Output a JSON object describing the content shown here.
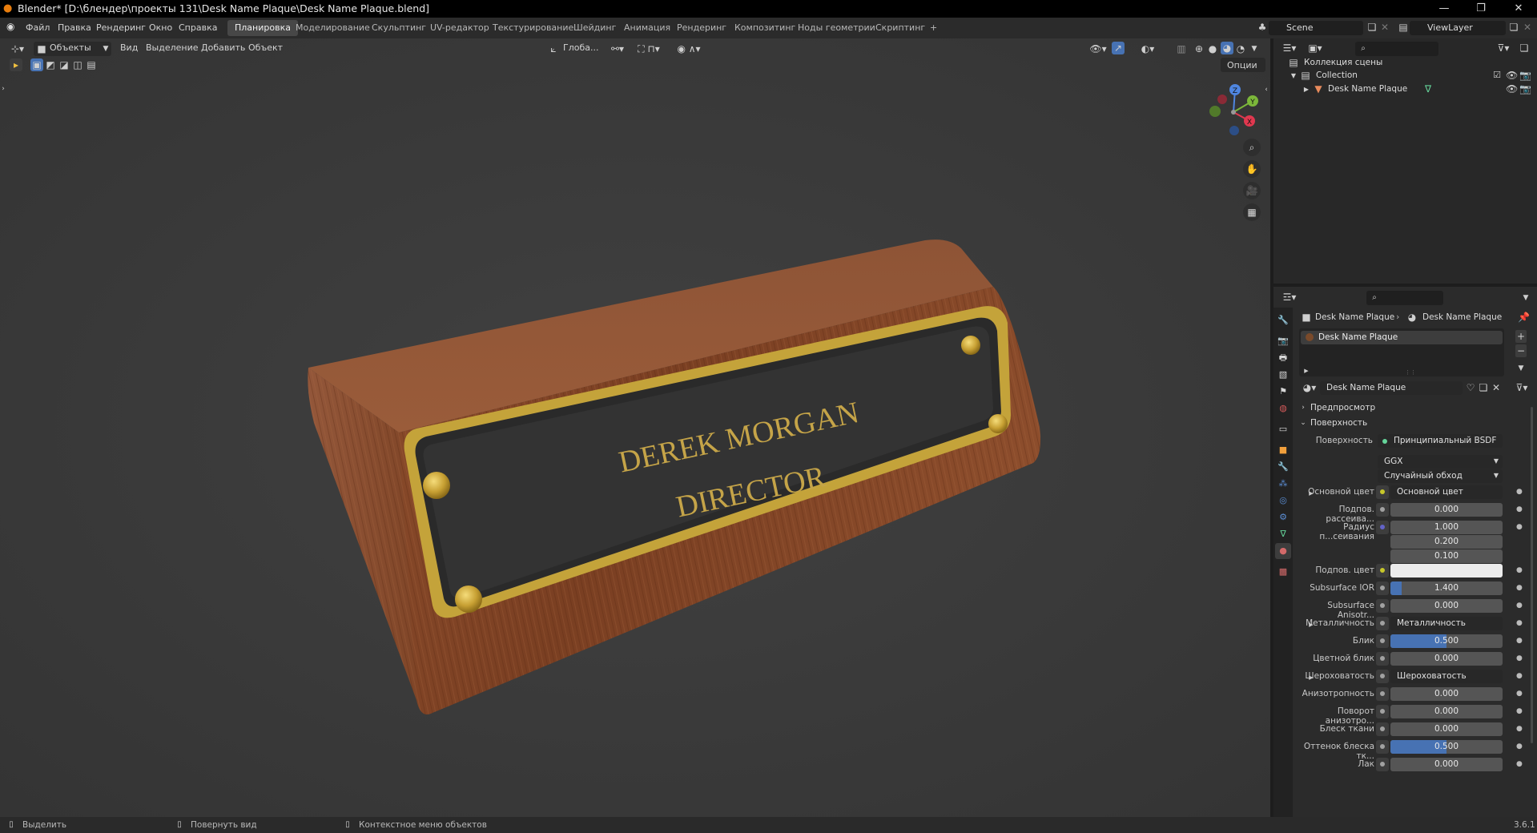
{
  "window": {
    "title": "Blender* [D:\\блендер\\проекты 131\\Desk Name Plaque\\Desk Name Plaque.blend]"
  },
  "menu": [
    "Файл",
    "Правка",
    "Рендеринг",
    "Окно",
    "Справка"
  ],
  "workspaces": [
    "Планировка",
    "Моделирование",
    "Скульптинг",
    "UV-редактор",
    "Текстурирование",
    "Шейдинг",
    "Анимация",
    "Рендеринг",
    "Композитинг",
    "Ноды геометрии",
    "Скриптинг"
  ],
  "workspace_add": "+",
  "scene": {
    "name": "Scene",
    "view_layer": "ViewLayer"
  },
  "viewport": {
    "mode": "Объекты",
    "menus": [
      "Вид",
      "Выделение",
      "Добавить",
      "Объект"
    ],
    "transform": "Глоба...",
    "options": "Опции",
    "plaque_line1": "DEREK MORGAN",
    "plaque_line2": "DIRECTOR",
    "axes": {
      "x": "X",
      "y": "Y",
      "z": "Z"
    }
  },
  "outliner": {
    "root": "Коллекция сцены",
    "collection": "Collection",
    "object": "Desk Name Plaque"
  },
  "properties": {
    "breadcrumb_object": "Desk Name Plaque",
    "breadcrumb_material": "Desk Name Plaque",
    "slot": "Desk Name Plaque",
    "material_name": "Desk Name Plaque",
    "sections": {
      "preview": "Предпросмотр",
      "surface": "Поверхность"
    },
    "surface_label": "Поверхность",
    "surface_value": "Принципиальный BSDF",
    "distribution": "GGX",
    "subsurface_method": "Случайный обход",
    "rows": [
      {
        "label": "Основной цвет",
        "kind": "link",
        "value": "Основной цвет",
        "color": "#c7c72a",
        "expand": true
      },
      {
        "label": "Подпов. рассеива...",
        "kind": "num",
        "value": "0.000",
        "color": "#a1a1a1"
      },
      {
        "label": "Радиус п...сеивания",
        "kind": "num",
        "value": "1.000",
        "color": "#6363c7"
      },
      {
        "label": "",
        "kind": "num",
        "value": "0.200"
      },
      {
        "label": "",
        "kind": "num",
        "value": "0.100"
      },
      {
        "label": "Подпов. цвет",
        "kind": "color",
        "value": "",
        "color": "#c7c72a"
      },
      {
        "label": "Subsurface IOR",
        "kind": "num",
        "value": "1.400",
        "color": "#a1a1a1",
        "fill": 0.1
      },
      {
        "label": "Subsurface Anisotr...",
        "kind": "num",
        "value": "0.000",
        "color": "#a1a1a1"
      },
      {
        "label": "Металличность",
        "kind": "link",
        "value": "Металличность",
        "color": "#a1a1a1",
        "expand": true
      },
      {
        "label": "Блик",
        "kind": "num",
        "value": "0.500",
        "color": "#a1a1a1",
        "fill": 0.5
      },
      {
        "label": "Цветной блик",
        "kind": "num",
        "value": "0.000",
        "color": "#a1a1a1"
      },
      {
        "label": "Шероховатость",
        "kind": "link",
        "value": "Шероховатость",
        "color": "#a1a1a1",
        "expand": true
      },
      {
        "label": "Анизотропность",
        "kind": "num",
        "value": "0.000",
        "color": "#a1a1a1"
      },
      {
        "label": "Поворот анизотро...",
        "kind": "num",
        "value": "0.000",
        "color": "#a1a1a1"
      },
      {
        "label": "Блеск ткани",
        "kind": "num",
        "value": "0.000",
        "color": "#a1a1a1"
      },
      {
        "label": "Оттенок блеска тк...",
        "kind": "num",
        "value": "0.500",
        "color": "#a1a1a1",
        "fill": 0.5
      },
      {
        "label": "Лак",
        "kind": "num",
        "value": "0.000",
        "color": "#a1a1a1"
      }
    ]
  },
  "status": {
    "select": "Выделить",
    "rotate": "Повернуть вид",
    "context": "Контекстное меню объектов",
    "version": "3.6.1"
  }
}
